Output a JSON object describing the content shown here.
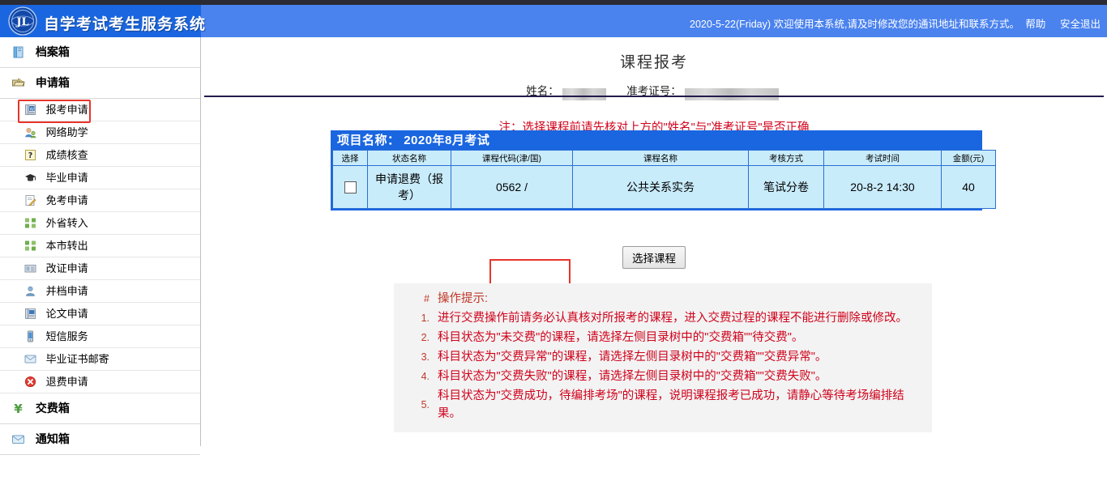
{
  "header": {
    "brand": "自学考试考生服务系统",
    "info": "2020-5-22(Friday) 欢迎使用本系统,请及时修改您的通讯地址和联系方式。",
    "help_label": "帮助",
    "logout_label": "安全退出",
    "colors": {
      "left_blue": "#1a66e0",
      "right_blue": "#4a82ee"
    }
  },
  "sidebar": {
    "groups": [
      {
        "label": "档案箱",
        "icon": "archive-box-icon",
        "items": []
      },
      {
        "label": "申请箱",
        "icon": "application-box-icon",
        "items": [
          {
            "label": "报考申请",
            "icon": "exam-apply-icon",
            "selected": true
          },
          {
            "label": "网络助学",
            "icon": "online-learning-icon",
            "selected": false
          },
          {
            "label": "成绩核查",
            "icon": "score-check-icon",
            "selected": false
          },
          {
            "label": "毕业申请",
            "icon": "graduation-cap-icon",
            "selected": false
          },
          {
            "label": "免考申请",
            "icon": "exemption-icon",
            "selected": false
          },
          {
            "label": "外省转入",
            "icon": "transfer-in-icon",
            "selected": false
          },
          {
            "label": "本市转出",
            "icon": "transfer-out-icon",
            "selected": false
          },
          {
            "label": "改证申请",
            "icon": "id-change-icon",
            "selected": false
          },
          {
            "label": "并档申请",
            "icon": "merge-file-icon",
            "selected": false
          },
          {
            "label": "论文申请",
            "icon": "thesis-icon",
            "selected": false
          },
          {
            "label": "短信服务",
            "icon": "sms-icon",
            "selected": false
          },
          {
            "label": "毕业证书邮寄",
            "icon": "mail-certificate-icon",
            "selected": false
          },
          {
            "label": "退费申请",
            "icon": "refund-icon",
            "selected": false
          }
        ]
      },
      {
        "label": "交费箱",
        "icon": "payment-box-icon",
        "items": []
      },
      {
        "label": "通知箱",
        "icon": "notice-box-icon",
        "items": []
      }
    ],
    "highlight_color": "#e8342a"
  },
  "main": {
    "page_title": "课程报考",
    "name_label": "姓名：",
    "name_value": "",
    "ticket_label": "准考证号：",
    "ticket_value": "",
    "note": "注：选择课程前请先核对上方的\"姓名\"与\"准考证号\"是否正确",
    "note_color": "#d0021b",
    "table": {
      "caption_label": "项目名称：",
      "caption_value": "2020年8月考试",
      "headers": [
        "选择",
        "状态名称",
        "课程代码(津/国)",
        "课程名称",
        "考核方式",
        "考试时间",
        "金额(元)"
      ],
      "rows": [
        {
          "selected": false,
          "status": "申请退费（报考）",
          "code": "0562 /",
          "course": "公共关系实务",
          "mode": "笔试分卷",
          "time": "20-8-2 14:30",
          "amount": "40"
        }
      ]
    },
    "select_course_button": "选择课程",
    "tips": {
      "marker": "#",
      "title": "操作提示:",
      "items": [
        {
          "num": "1.",
          "text": "进行交费操作前请务必认真核对所报考的课程，进入交费过程的课程不能进行删除或修改。"
        },
        {
          "num": "2.",
          "text": "科目状态为\"未交费\"的课程，请选择左侧目录树中的\"交费箱\"\"待交费\"。"
        },
        {
          "num": "3.",
          "text": "科目状态为\"交费异常\"的课程，请选择左侧目录树中的\"交费箱\"\"交费异常\"。"
        },
        {
          "num": "4.",
          "text": "科目状态为\"交费失败\"的课程，请选择左侧目录树中的\"交费箱\"\"交费失败\"。"
        },
        {
          "num": "5.",
          "text": "科目状态为\"交费成功，待编排考场\"的课程，说明课程报考已成功，请静心等待考场编排结果。"
        }
      ]
    }
  }
}
